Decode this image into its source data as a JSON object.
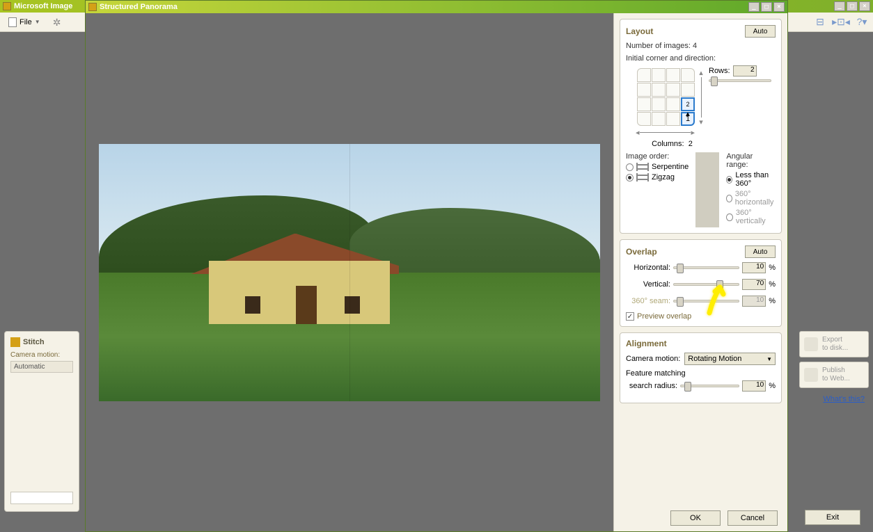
{
  "parent": {
    "title": "Microsoft Image",
    "file_label": "File",
    "export_label": "Export\nto disk...",
    "publish_label": "Publish\nto Web...",
    "whats_this": "What's this?",
    "exit_label": "Exit"
  },
  "stitch": {
    "title": "Stitch",
    "camera_motion_label": "Camera motion:",
    "camera_motion_value": "Automatic"
  },
  "dialog": {
    "title": "Structured Panorama",
    "ok_label": "OK",
    "cancel_label": "Cancel"
  },
  "layout": {
    "title": "Layout",
    "auto_label": "Auto",
    "num_images_label": "Number of images: 4",
    "initial_label": "Initial corner and direction:",
    "rows_label": "Rows:",
    "rows_value": "2",
    "columns_label": "Columns:",
    "columns_value": "2",
    "cell_2": "2",
    "cell_1": "1",
    "image_order_label": "Image order:",
    "serpentine": "Serpentine",
    "zigzag": "Zigzag",
    "angular_label": "Angular range:",
    "less360": "Less than 360°",
    "h360": "360° horizontally",
    "v360": "360° vertically"
  },
  "overlap": {
    "title": "Overlap",
    "auto_label": "Auto",
    "horizontal_label": "Horizontal:",
    "horizontal_value": "10",
    "vertical_label": "Vertical:",
    "vertical_value": "70",
    "seam_label": "360° seam:",
    "seam_value": "10",
    "preview_label": "Preview overlap",
    "pct": "%"
  },
  "alignment": {
    "title": "Alignment",
    "camera_motion_label": "Camera motion:",
    "camera_motion_value": "Rotating Motion",
    "feature_label": "Feature matching",
    "search_radius_label": "search radius:",
    "search_radius_value": "10",
    "pct": "%"
  }
}
